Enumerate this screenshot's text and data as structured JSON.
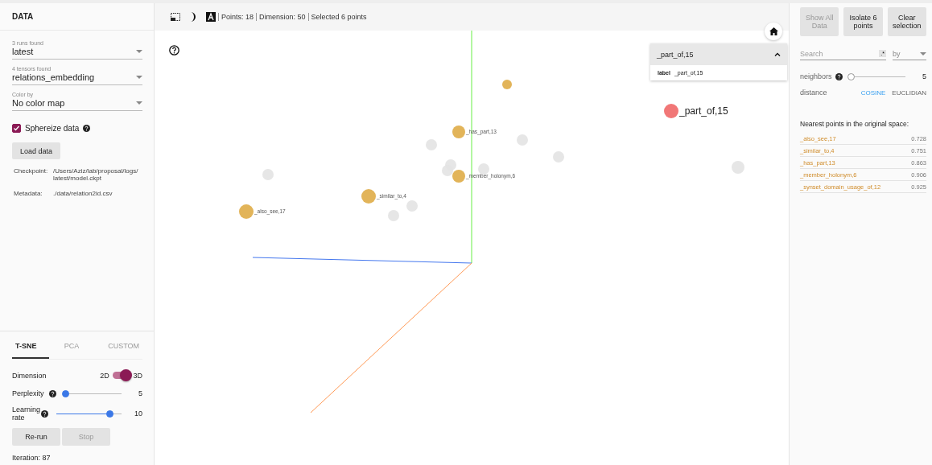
{
  "left_panel": {
    "title": "DATA",
    "selects": [
      {
        "label": "3 runs found",
        "value": "latest"
      },
      {
        "label": "4 tensors found",
        "value": "relations_embedding"
      },
      {
        "label": "Color by",
        "value": "No color map"
      }
    ],
    "spherize": {
      "label": "Sphereize data",
      "checked": true
    },
    "load_button": "Load data",
    "info": [
      {
        "key": "Checkpoint:",
        "value": "/Users/Aziz/lab/proposal/logs/ latest/model.ckpt"
      },
      {
        "key": "Metadata:",
        "value": "./data/relation2id.csv"
      }
    ],
    "tabs": [
      {
        "label": "T-SNE",
        "selected": true
      },
      {
        "label": "PCA",
        "selected": false
      },
      {
        "label": "CUSTOM",
        "selected": false
      }
    ],
    "dimension": {
      "label": "Dimension",
      "off_label": "2D",
      "on_label": "3D",
      "on": true
    },
    "sliders": [
      {
        "label": "Perplexity",
        "level": 0.02,
        "reading": "5"
      },
      {
        "label": "Learning rate",
        "level": 0.82,
        "reading": "10"
      }
    ],
    "buttons": [
      {
        "label": "Re-run",
        "disabled": false
      },
      {
        "label": "Stop",
        "disabled": true
      }
    ],
    "iteration": "Iteration: 87"
  },
  "toolbar": {
    "stats": [
      "Points: 18",
      "Dimension: 50",
      "Selected 6 points"
    ]
  },
  "card": {
    "title": "_part_of,15",
    "expanded": true,
    "key": "label",
    "value": "_part_of,15"
  },
  "points": [
    {
      "kind": "neighbor",
      "label": "_also_see,17"
    },
    {
      "kind": "neighbor",
      "label": "_similar_to,4"
    },
    {
      "kind": "neighbor",
      "label": "_has_part,13"
    },
    {
      "kind": "neighbor",
      "label": "_member_holonym,6"
    },
    {
      "kind": "neighbor"
    },
    {
      "kind": "focus",
      "label": "_part_of,15"
    },
    {
      "kind": "other"
    },
    {
      "kind": "other"
    },
    {
      "kind": "other"
    },
    {
      "kind": "other"
    },
    {
      "kind": "other"
    },
    {
      "kind": "other"
    },
    {
      "kind": "other"
    },
    {
      "kind": "other"
    },
    {
      "kind": "other"
    },
    {
      "kind": "other"
    }
  ],
  "right_panel": {
    "buttons": [
      {
        "label": "Show All Data",
        "disabled": true
      },
      {
        "label": "Isolate 6 points",
        "disabled": false
      },
      {
        "label": "Clear selection",
        "disabled": false
      }
    ],
    "search": {
      "placeholder": "Search",
      "regex": ".*",
      "by": "by"
    },
    "neighbors": {
      "label": "neighbors",
      "level": 0,
      "reading": "5"
    },
    "distance": {
      "label": "distance",
      "options": [
        {
          "label": "COSINE",
          "selected": true
        },
        {
          "label": "EUCLIDIAN",
          "selected": false
        }
      ]
    },
    "nearest_title": "Nearest points in the original space:",
    "nearest": [
      {
        "label": "_also_see,17",
        "value": "0.728"
      },
      {
        "label": "_similar_to,4",
        "value": "0.751"
      },
      {
        "label": "_has_part,13",
        "value": "0.863"
      },
      {
        "label": "_member_holonym,6",
        "value": "0.906"
      },
      {
        "label": "_synset_domain_usage_of,12",
        "value": "0.925"
      }
    ]
  }
}
